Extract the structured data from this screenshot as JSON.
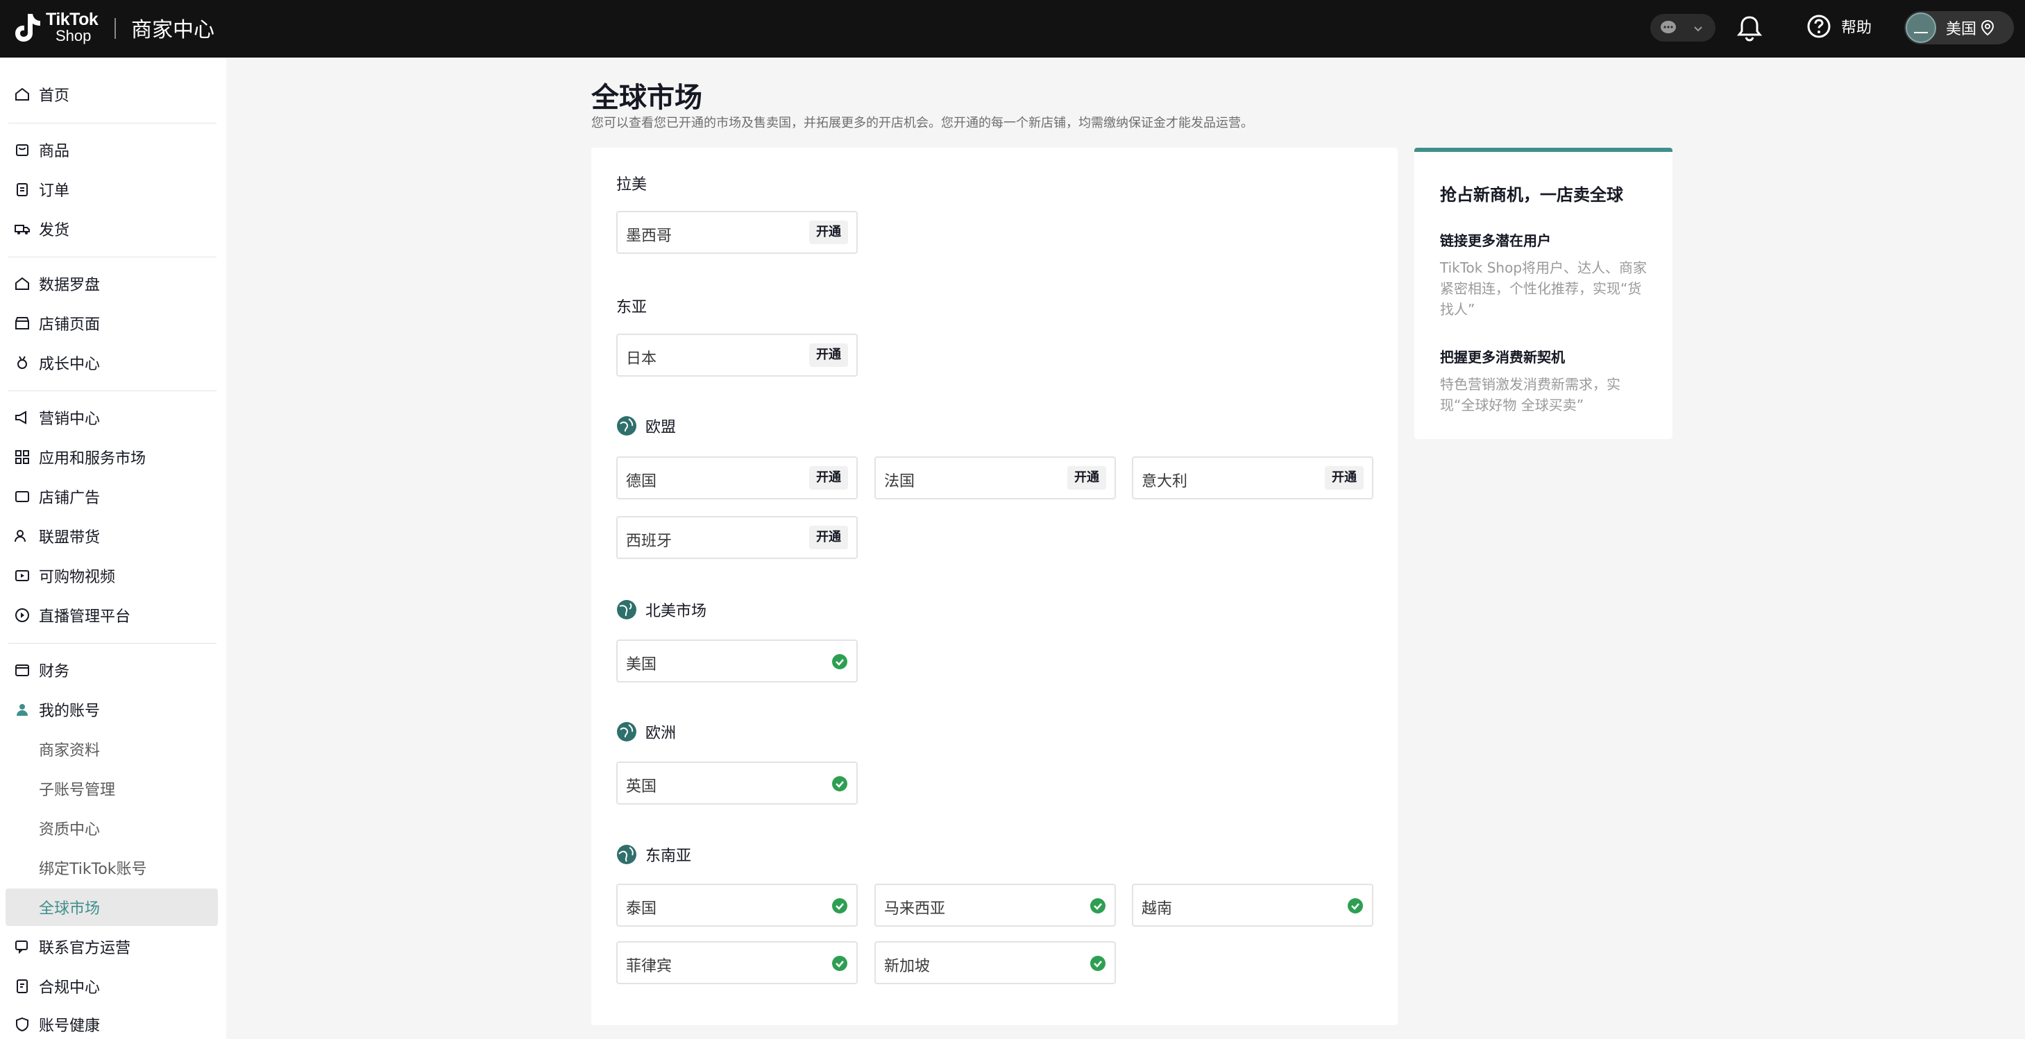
{
  "header": {
    "logo_line1": "TikTok",
    "logo_line2": "Shop",
    "title": "商家中心",
    "help_label": "帮助",
    "account_region": "美国"
  },
  "sidebar": {
    "items": [
      {
        "label": "首页",
        "icon": "home-icon"
      },
      {
        "label": "商品",
        "icon": "product-icon"
      },
      {
        "label": "订单",
        "icon": "order-icon"
      },
      {
        "label": "发货",
        "icon": "truck-icon"
      },
      {
        "label": "数据罗盘",
        "icon": "compass-icon"
      },
      {
        "label": "店铺页面",
        "icon": "store-icon"
      },
      {
        "label": "成长中心",
        "icon": "medal-icon"
      },
      {
        "label": "营销中心",
        "icon": "megaphone-icon"
      },
      {
        "label": "应用和服务市场",
        "icon": "apps-icon"
      },
      {
        "label": "店铺广告",
        "icon": "ad-icon"
      },
      {
        "label": "联盟带货",
        "icon": "affiliate-icon"
      },
      {
        "label": "可购物视频",
        "icon": "video-icon"
      },
      {
        "label": "直播管理平台",
        "icon": "live-icon"
      },
      {
        "label": "财务",
        "icon": "wallet-icon"
      },
      {
        "label": "我的账号",
        "icon": "user-icon"
      },
      {
        "label": "商家资料"
      },
      {
        "label": "子账号管理"
      },
      {
        "label": "资质中心"
      },
      {
        "label": "绑定TikTok账号"
      },
      {
        "label": "全球市场"
      },
      {
        "label": "联系官方运营",
        "icon": "chat-icon"
      },
      {
        "label": "合规中心",
        "icon": "compliance-icon"
      },
      {
        "label": "账号健康",
        "icon": "shield-icon"
      }
    ]
  },
  "main": {
    "title": "全球市场",
    "subtitle": "您可以查看您已开通的市场及售卖国，并拓展更多的开店机会。您开通的每一个新店铺，均需缴纳保证金才能发品运营。",
    "open_label": "开通",
    "regions": [
      {
        "name": "拉美",
        "countries": [
          "墨西哥"
        ]
      },
      {
        "name": "东亚",
        "countries": [
          "日本"
        ]
      },
      {
        "name": "欧盟",
        "countries": [
          "德国",
          "法国",
          "意大利",
          "西班牙"
        ]
      },
      {
        "name": "北美市场",
        "countries": [
          "美国"
        ]
      },
      {
        "name": "欧洲",
        "countries": [
          "英国"
        ]
      },
      {
        "name": "东南亚",
        "countries": [
          "泰国",
          "马来西亚",
          "越南",
          "菲律宾",
          "新加坡"
        ]
      }
    ]
  },
  "promo": {
    "title": "抢占新商机，一店卖全球",
    "h1": "链接更多潜在用户",
    "d1": "TikTok Shop将用户、达人、商家紧密相连，个性化推荐，实现“货找人”",
    "h2": "把握更多消费新契机",
    "d2": "特色营销激发消费新需求，实现“全球好物 全球买卖”"
  },
  "colors": {
    "accent": "#3f8f8b",
    "topbar": "#121212",
    "success": "#2e9f52"
  }
}
